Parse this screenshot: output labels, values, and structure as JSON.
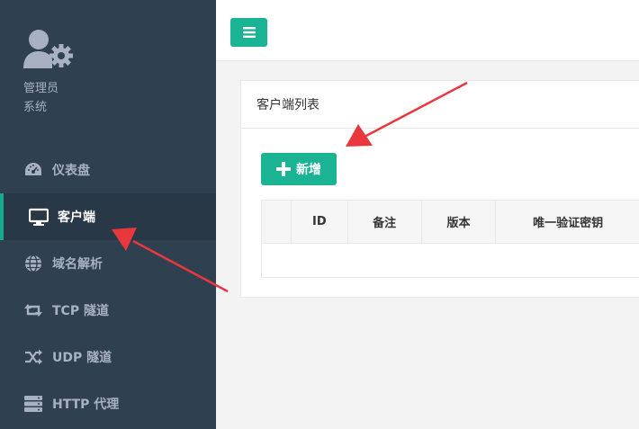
{
  "profile": {
    "icon": "user-gear-icon",
    "name": "管理员",
    "role": "系统"
  },
  "nav": [
    {
      "icon": "dashboard-icon",
      "label": "仪表盘",
      "active": false
    },
    {
      "icon": "monitor-icon",
      "label": "客户端",
      "active": true
    },
    {
      "icon": "globe-icon",
      "label": "域名解析",
      "active": false
    },
    {
      "icon": "retweet-icon",
      "label": "TCP 隧道",
      "active": false
    },
    {
      "icon": "shuffle-icon",
      "label": "UDP 隧道",
      "active": false
    },
    {
      "icon": "server-icon",
      "label": "HTTP 代理",
      "active": false
    }
  ],
  "topbar": {
    "menu_icon": "hamburger-icon"
  },
  "panel": {
    "title": "客户端列表",
    "add_label": "新增",
    "table": {
      "headers": [
        "",
        "ID",
        "备注",
        "版本",
        "唯一验证密钥"
      ],
      "rows": []
    }
  },
  "colors": {
    "sidebar": "#2f4050",
    "sidebar_active": "#293846",
    "accent": "#1ab394",
    "annotation_arrow": "#e8383d"
  }
}
